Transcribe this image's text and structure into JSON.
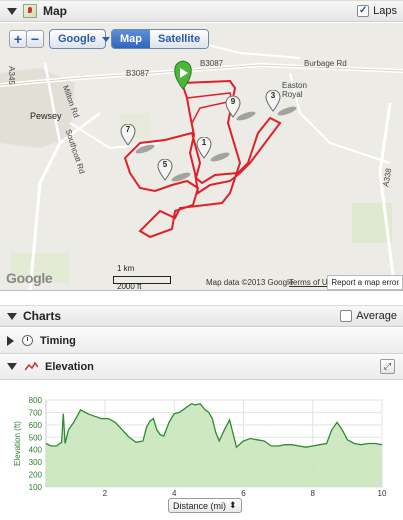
{
  "map_panel": {
    "title": "Map",
    "laps_label": "Laps",
    "laps_checked": true,
    "zoom_in": "+",
    "zoom_out": "−",
    "provider": "Google",
    "map_types": [
      {
        "label": "Map",
        "active": true
      },
      {
        "label": "Satellite",
        "active": false
      }
    ],
    "places": {
      "b3087_left": "B3087",
      "b3087_right": "B3087",
      "burbage": "Burbage Rd",
      "easton": "Easton\nRoyal",
      "pewsey": "Pewsey",
      "milton": "Milton Rd",
      "southcott": "Southcott Rd",
      "a345": "A345",
      "a338": "A338"
    },
    "lap_markers": [
      "7",
      "5",
      "1",
      "9",
      "3"
    ],
    "google_logo": "Google",
    "scale_km": "1 km",
    "scale_ft": "2000 ft",
    "attribution": "Map data ©2013 Google",
    "terms": "Terms of Use",
    "report": "Report a map error",
    "colors": {
      "route": "#e0202a",
      "start": "#4bb53c",
      "land": "#ecebe5",
      "road": "#ffffff"
    }
  },
  "charts_panel": {
    "title": "Charts",
    "average_label": "Average",
    "average_checked": false,
    "timing_label": "Timing",
    "elevation_label": "Elevation"
  },
  "chart_data": {
    "type": "area",
    "ylabel": "Elevation (ft)",
    "xlabel": "Distance (mi)",
    "ylim": [
      100,
      800
    ],
    "xlim": [
      0.3,
      10
    ],
    "yticks": [
      100,
      200,
      300,
      400,
      500,
      600,
      700,
      800
    ],
    "xticks": [
      2,
      4,
      6,
      8,
      10
    ],
    "grid": true,
    "series": [
      {
        "color": "#2e8b2e",
        "fill": "#c8e6bd",
        "x": [
          0.3,
          0.45,
          0.6,
          0.75,
          0.8,
          0.85,
          0.95,
          1.1,
          1.3,
          1.5,
          1.7,
          1.9,
          2.1,
          2.3,
          2.5,
          2.7,
          2.9,
          3.1,
          3.2,
          3.3,
          3.4,
          3.5,
          3.6,
          3.7,
          3.85,
          4.0,
          4.15,
          4.3,
          4.5,
          4.6,
          4.75,
          4.9,
          5.0,
          5.1,
          5.2,
          5.3,
          5.45,
          5.6,
          5.8,
          6.0,
          6.2,
          6.4,
          6.6,
          6.8,
          7.0,
          7.2,
          7.4,
          7.6,
          7.8,
          8.0,
          8.2,
          8.4,
          8.55,
          8.7,
          8.85,
          9.0,
          9.2,
          9.4,
          9.6,
          9.8,
          10.0
        ],
        "values": [
          450,
          430,
          430,
          460,
          690,
          450,
          560,
          620,
          720,
          690,
          670,
          650,
          650,
          620,
          560,
          500,
          460,
          470,
          580,
          630,
          650,
          560,
          520,
          510,
          620,
          690,
          700,
          730,
          770,
          760,
          770,
          720,
          700,
          650,
          540,
          470,
          560,
          640,
          420,
          470,
          490,
          480,
          470,
          430,
          430,
          440,
          440,
          430,
          420,
          430,
          440,
          450,
          560,
          620,
          560,
          480,
          450,
          440,
          450,
          450,
          440
        ]
      }
    ]
  }
}
